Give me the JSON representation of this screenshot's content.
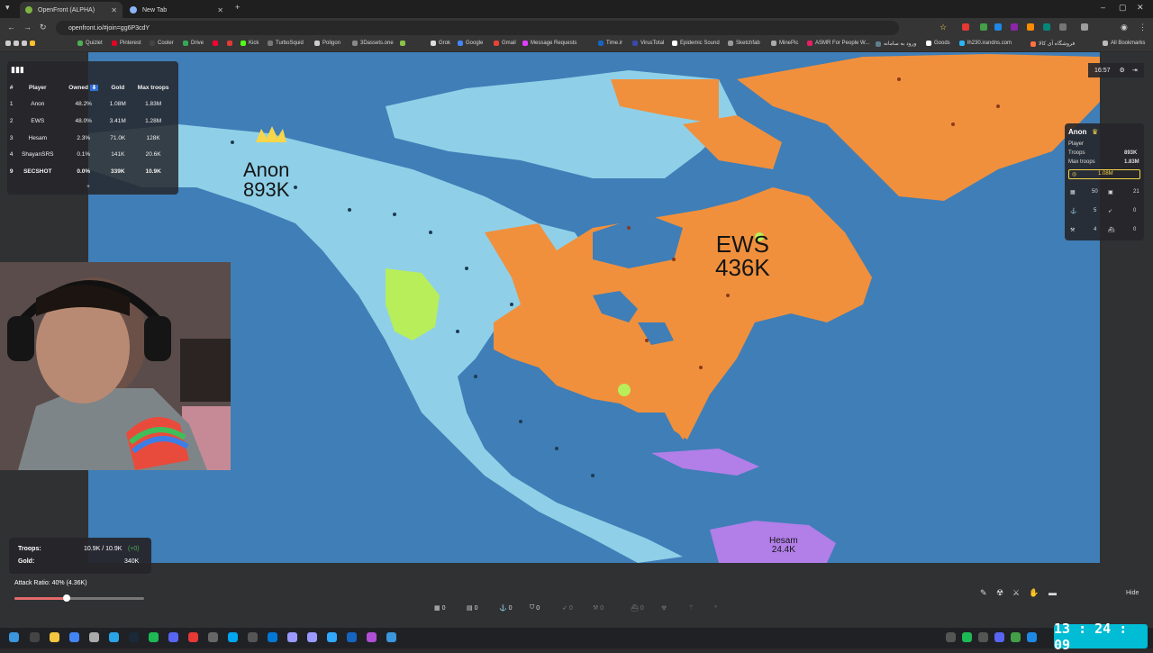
{
  "browser": {
    "tabs": [
      {
        "title": "OpenFront (ALPHA)"
      },
      {
        "title": "New Tab"
      }
    ],
    "url": "openfront.io/#join=gg6P3cdY",
    "bookmarks": [
      "Quizlet",
      "Pinterest",
      "Cooler",
      "Drive",
      "",
      "Kick",
      "TurboSquid",
      "Poligon",
      "3Dassets.one",
      "",
      "Grok",
      "Google",
      "Gmail",
      "Message Requests",
      "Time.ir",
      "VirusTotal",
      "Epidemic Sound",
      "Sketchfab",
      "MinePic",
      "ASMR For People W...",
      "ورود به سامانه",
      "Goods",
      "lh230.irandns.com",
      "فروشگاه آی کالا"
    ],
    "all_bookmarks": "All Bookmarks"
  },
  "leaderboard": {
    "headers": [
      "#",
      "Player",
      "Owned",
      "Gold",
      "Max troops"
    ],
    "rows": [
      {
        "rank": "1",
        "player": "Anon",
        "owned": "48.2%",
        "gold": "1.08M",
        "max": "1.83M"
      },
      {
        "rank": "2",
        "player": "EWS",
        "owned": "48.0%",
        "gold": "3.41M",
        "max": "1.28M"
      },
      {
        "rank": "3",
        "player": "Hesam",
        "owned": "2.3%",
        "gold": "71.0K",
        "max": "128K"
      },
      {
        "rank": "4",
        "player": "ShayanSRS",
        "owned": "0.1%",
        "gold": "141K",
        "max": "20.6K"
      },
      {
        "rank": "9",
        "player": "SECSHOT",
        "owned": "0.0%",
        "gold": "339K",
        "max": "10.9K"
      }
    ],
    "more": "+"
  },
  "map_labels": {
    "anon_name": "Anon",
    "anon_troops": "893K",
    "ews_name": "EWS",
    "ews_troops": "436K",
    "hesam_name": "Hesam",
    "hesam_troops": "24.4K"
  },
  "timer": "16:57",
  "player_panel": {
    "name": "Anon",
    "type": "Player",
    "troops_label": "Troops",
    "troops": "893K",
    "max_label": "Max troops",
    "max": "1.83M",
    "gold": "1.08M",
    "rows": [
      {
        "a": "50",
        "b": "21"
      },
      {
        "a": "5",
        "b": "0"
      },
      {
        "a": "4",
        "b": "0"
      }
    ]
  },
  "stats": {
    "troops_label": "Troops:",
    "troops_value": "10.9K / 10.9K",
    "troops_delta": "(+0)",
    "gold_label": "Gold:",
    "gold_value": "340K",
    "attack_ratio": "Attack Ratio: 40% (4.36K)",
    "attack_ratio_value": 0.4
  },
  "toolbar": {
    "counts": [
      "0",
      "0",
      "0",
      "0",
      "0",
      "0",
      "0"
    ]
  },
  "hide_label": "Hide",
  "clock": "13 : 24 : 09",
  "colors": {
    "ocean": "#3f7eb7",
    "anon": "#8fd0e8",
    "ews": "#f0903d",
    "hesam": "#b27ee8",
    "bot": "#b8ee5a"
  }
}
